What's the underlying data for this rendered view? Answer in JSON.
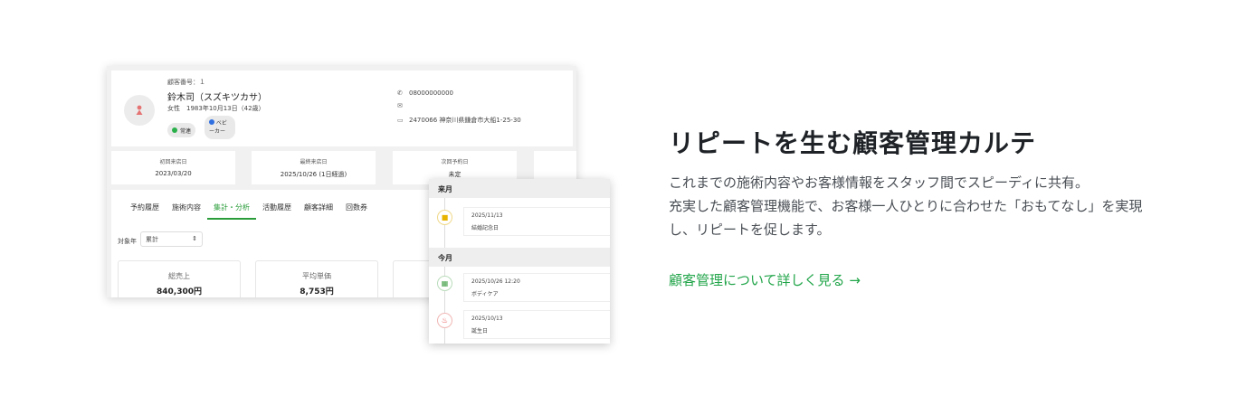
{
  "card": {
    "customer_number": "顧客番号：１",
    "name": "鈴木司（スズキツカサ）",
    "profile": "女性　1983年10月13日（42歳）",
    "badges": [
      {
        "label": "常連",
        "color": "#2ab04a"
      },
      {
        "label": "ベビーカー",
        "label_line1": "ベビ",
        "label_line2": "ーカー",
        "color": "#2f6fe0"
      }
    ],
    "phone": "08000000000",
    "email": "",
    "address": "2470066 神奈川県鎌倉市大船1-25-30",
    "stats": [
      {
        "label": "初回来店日",
        "value": "2023/03/20"
      },
      {
        "label": "最終来店日",
        "value": "2025/10/26 (1日経過)"
      },
      {
        "label": "次回予約日",
        "value": "未定"
      }
    ],
    "tabs": [
      "予約履歴",
      "施術内容",
      "集計・分析",
      "活動履歴",
      "顧客詳細",
      "回数券"
    ],
    "active_tab": "集計・分析",
    "filter_label": "対象年",
    "filter_value": "累計",
    "metrics": [
      {
        "label": "総売上",
        "value": "840,300円"
      },
      {
        "label": "平均単価",
        "value": "8,753円"
      }
    ]
  },
  "timeline": {
    "sections": [
      {
        "heading": "来月",
        "items": [
          {
            "date": "2025/11/13",
            "title": "結婚記念日",
            "icon": "gift-icon",
            "color": "#e8b400"
          }
        ]
      },
      {
        "heading": "今月",
        "items": [
          {
            "date": "2025/10/26 12:20",
            "title": "ボディケア",
            "icon": "calendar-icon",
            "color": "#43a047"
          },
          {
            "date": "2025/10/13",
            "title": "誕生日",
            "icon": "birthday-cake-icon",
            "color": "#e53935"
          }
        ]
      }
    ]
  },
  "copy": {
    "headline": "リピートを生む顧客管理カルテ",
    "desc_line1": "これまでの施術内容やお客様情報をスタッフ間でスピーディに共有。",
    "desc_line2": "充実した顧客管理機能で、お客様一人ひとりに合わせた「おもてなし」を実現",
    "desc_line3": "し、リピートを促します。",
    "link": "顧客管理について詳しく見る →"
  },
  "colors": {
    "accent": "#22a54a",
    "tab_active": "#2a9d3a"
  }
}
